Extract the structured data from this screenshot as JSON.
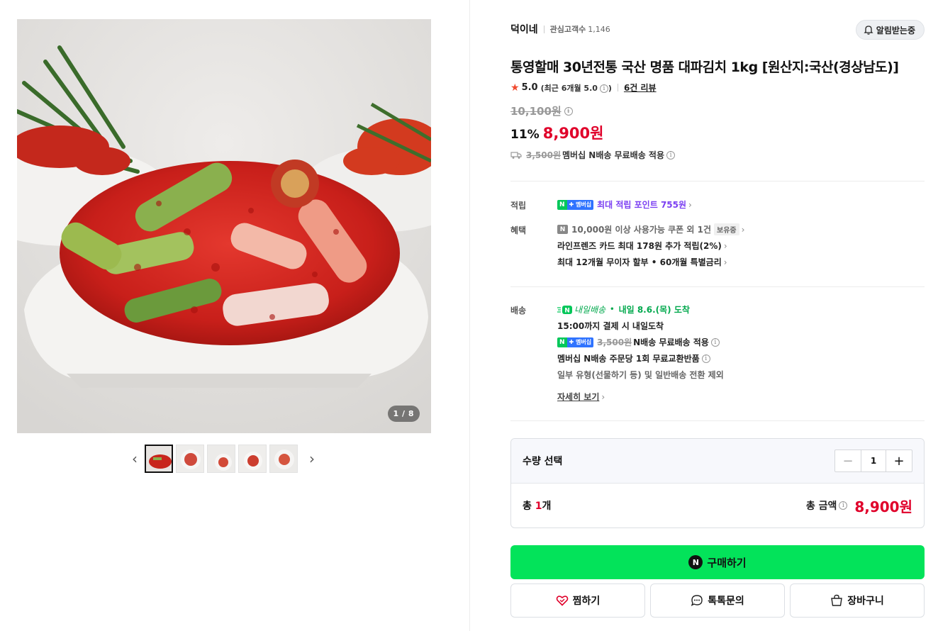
{
  "gallery": {
    "counter": "1 / 8",
    "prev_icon": "chevron-left-icon",
    "next_icon": "chevron-right-icon",
    "thumbnail_count": 5
  },
  "store": {
    "name": "덕이네",
    "fans_label": "관심고객수",
    "fans_count": "1,146",
    "alarm_label": "알림받는중"
  },
  "product": {
    "title": "통영할매 30년전통 국산 명품 대파김치 1kg [원산지:국산(경상남도)]",
    "rating": "5.0",
    "rating_recent": "(최근 6개월 5.0",
    "rating_recent_close": ")",
    "review_link": "6건 리뷰",
    "original_price": "10,100원",
    "discount": "11%",
    "sale_price": "8,900원",
    "shipping_strike": "3,500원",
    "shipping_text": "멤버십 N배송 무료배송 적용"
  },
  "points": {
    "label": "적립",
    "badge_n": "N",
    "badge_plus": "✚ 멤버십",
    "text": "최대 적립 포인트 755원"
  },
  "benefits": {
    "label": "혜택",
    "coupon_icon": "N",
    "coupon_text": "10,000원 이상 사용가능 쿠폰 외 1건",
    "coupon_pill": "보유중",
    "card_text": "라인프렌즈 카드 최대 178원 추가 적립(2%)",
    "installment_text": "최대 12개월 무이자 할부 • 60개월 특별금리"
  },
  "delivery": {
    "label": "배송",
    "badge_text": "내일배송",
    "arrival": "내일 8.6.(목) 도착",
    "cutoff": "15:00까지 결제 시 내일도착",
    "fee_strike": "3,500원",
    "fee_text": "N배송 무료배송 적용",
    "exchange": "멤버십 N배송 주문당 1회 무료교환반품",
    "exception": "일부 유형(선물하기 등) 및 일반배송 전환 제외",
    "detail_link": "자세히 보기"
  },
  "quantity": {
    "title": "수량 선택",
    "minus": "−",
    "value": "1",
    "plus": "+",
    "total_prefix": "총 ",
    "total_count": "1",
    "total_suffix": "개",
    "total_amount_label": "총 금액",
    "total_amount": "8,900원"
  },
  "actions": {
    "buy_icon": "N",
    "buy_label": "구매하기",
    "wish_label": "찜하기",
    "talk_label": "톡톡문의",
    "cart_label": "장바구니"
  },
  "colors": {
    "accent_red": "#e0002a",
    "buy_green": "#03e35a",
    "naver_green": "#03c75a",
    "membership_purple": "#7b3ff2"
  }
}
